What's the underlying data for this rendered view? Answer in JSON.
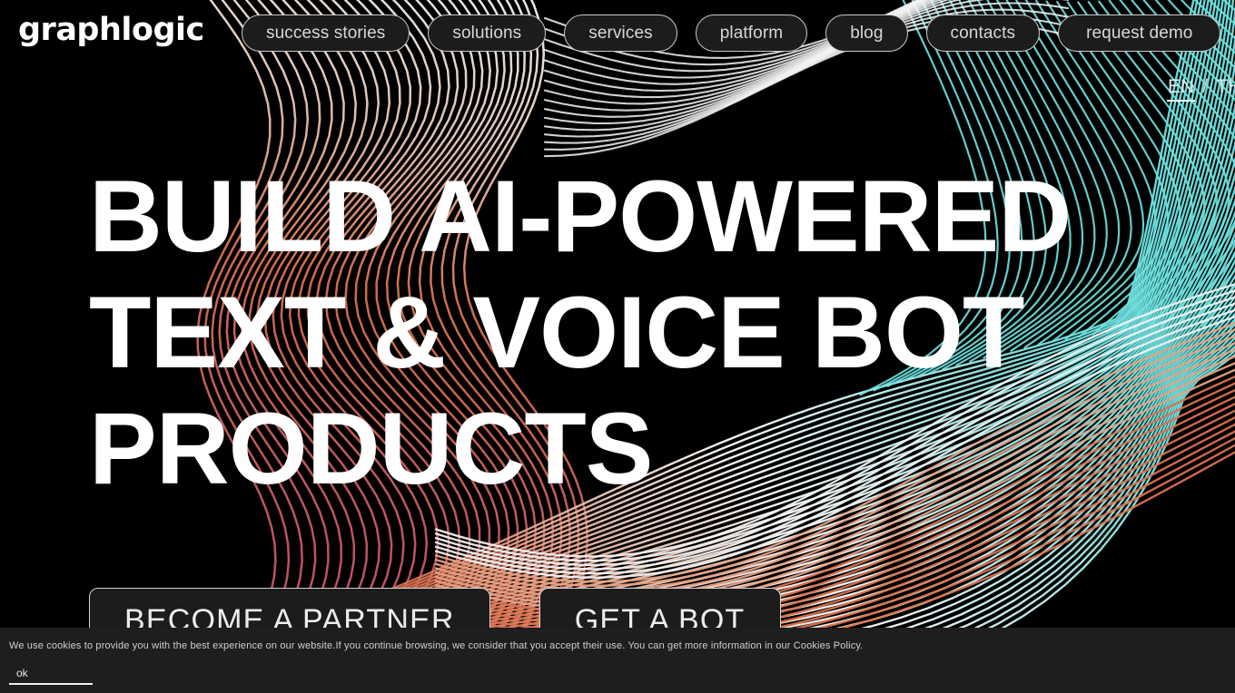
{
  "brand": {
    "logo": "graphlogic"
  },
  "nav": {
    "items": [
      {
        "label": "success stories",
        "name": "nav-success-stories"
      },
      {
        "label": "solutions",
        "name": "nav-solutions"
      },
      {
        "label": "services",
        "name": "nav-services"
      },
      {
        "label": "platform",
        "name": "nav-platform"
      },
      {
        "label": "blog",
        "name": "nav-blog"
      },
      {
        "label": "contacts",
        "name": "nav-contacts"
      },
      {
        "label": "request demo",
        "name": "nav-request-demo"
      }
    ]
  },
  "language": {
    "active": "EN",
    "separator": "/",
    "alternate": "TH"
  },
  "hero": {
    "title_lines": [
      "BUILD AI-POWERED",
      "TEXT & VOICE BOT",
      "PRODUCTS"
    ],
    "cta_primary": "BECOME A PARTNER",
    "cta_secondary": "GET A BOT"
  },
  "cookies": {
    "message": "We use cookies to provide you with the best experience on our website.If you continue browsing, we consider that you accept their use. You can get more information in our Cookies Policy.",
    "accept_label": "ok"
  },
  "colors": {
    "page_background": "#000000",
    "pill_background": "#1c1c1c",
    "pill_border": "#c9c9c9",
    "text_primary": "#ffffff",
    "text_muted": "#d7d7d7",
    "cookie_background": "#1e1e1e",
    "wave_cyan": "#6fe3e1",
    "wave_white": "#ffffff",
    "wave_coral": "#d9714d",
    "wave_pink": "#c94a6e"
  }
}
